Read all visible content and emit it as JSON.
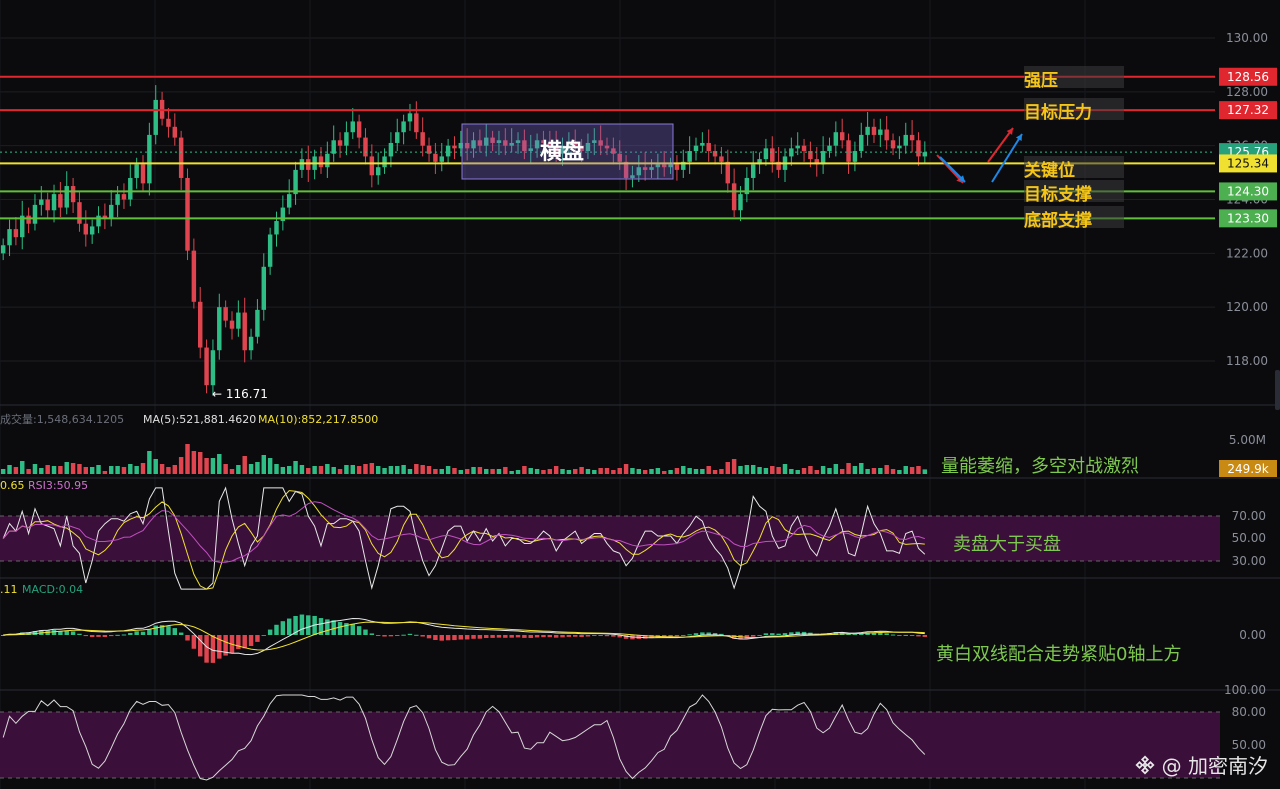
{
  "colors": {
    "background": "#0b0b0e",
    "up": "#2ebd85",
    "down": "#e0454f",
    "resistance_line": "#e0272f",
    "key_line": "#f0e130",
    "support_line": "#5fbf3a",
    "label_gold": "#f5c518",
    "note_green": "#7ec850",
    "osc_band": "#3a0f3a"
  },
  "annotations": {
    "strong_resistance": "强压",
    "target_resistance": "目标压力",
    "key_level": "关键位",
    "target_support": "目标支撑",
    "bottom_support": "底部支撑",
    "consolidation": "横盘",
    "volume_note": "量能萎缩，多空对战激烈",
    "rsi_note": "卖盘大于买盘",
    "macd_note": "黄白双线配合走势紧贴0轴上方",
    "low_marker": "← 116.71"
  },
  "watermark": {
    "text": "@ 加密南汐",
    "icon": "binance-logo-icon"
  },
  "chart_data": {
    "type": "candlestick",
    "price_axis": {
      "ticks": [
        "130.00",
        "128.00",
        "126.00",
        "124.00",
        "122.00",
        "120.00",
        "118.00"
      ],
      "ylim": [
        116.0,
        130.5
      ]
    },
    "price_tags": [
      {
        "value": "128.56",
        "kind": "resistance"
      },
      {
        "value": "127.32",
        "kind": "resistance"
      },
      {
        "value": "125.76",
        "kind": "current"
      },
      {
        "value": "125.34",
        "kind": "key"
      },
      {
        "value": "124.30",
        "kind": "support"
      },
      {
        "value": "123.30",
        "kind": "support"
      }
    ],
    "levels": [
      {
        "label": "强压",
        "price": 128.56,
        "color": "#e0272f"
      },
      {
        "label": "目标压力",
        "price": 127.32,
        "color": "#e0272f"
      },
      {
        "label": "关键位",
        "price": 125.34,
        "color": "#f0e130"
      },
      {
        "label": "目标支撑",
        "price": 124.3,
        "color": "#5fbf3a"
      },
      {
        "label": "底部支撑",
        "price": 123.3,
        "color": "#5fbf3a"
      }
    ],
    "low": 116.71,
    "close": [
      122.3,
      122.9,
      122.6,
      123.4,
      123.1,
      123.8,
      124.0,
      123.6,
      124.2,
      123.7,
      124.5,
      123.9,
      123.1,
      122.7,
      123.0,
      123.4,
      123.3,
      123.8,
      124.2,
      124.0,
      124.8,
      125.3,
      124.6,
      126.4,
      127.7,
      127.0,
      126.7,
      126.3,
      124.8,
      122.1,
      120.2,
      118.5,
      117.1,
      118.4,
      120.0,
      119.5,
      119.2,
      119.8,
      118.4,
      118.9,
      119.9,
      121.5,
      122.7,
      123.2,
      123.7,
      124.2,
      125.1,
      125.5,
      125.1,
      125.6,
      125.2,
      125.7,
      126.2,
      126.0,
      126.5,
      126.9,
      126.3,
      125.6,
      124.9,
      125.2,
      125.6,
      126.1,
      126.5,
      126.9,
      127.2,
      126.5,
      126.0,
      125.7,
      125.4,
      125.6,
      126.0,
      125.9,
      126.1,
      125.9,
      126.2,
      126.0,
      126.3,
      126.1,
      126.2,
      126.0,
      126.1,
      126.2,
      125.8,
      125.9,
      126.2,
      126.1,
      126.0,
      125.7,
      126.0,
      126.1,
      126.0,
      125.8,
      126.1,
      126.2,
      126.0,
      125.9,
      125.7,
      125.4,
      124.8,
      124.9,
      125.2,
      125.1,
      125.2,
      125.3,
      125.2,
      125.3,
      125.1,
      125.4,
      125.8,
      126.0,
      126.1,
      125.8,
      125.6,
      125.4,
      124.6,
      123.6,
      124.2,
      124.8,
      125.3,
      125.5,
      125.9,
      125.4,
      125.1,
      125.6,
      125.9,
      126.0,
      125.8,
      125.5,
      125.3,
      125.8,
      126.0,
      126.5,
      126.2,
      125.4,
      125.8,
      126.4,
      126.7,
      126.4,
      126.6,
      126.2,
      125.9,
      126.0,
      126.4,
      126.2,
      125.6,
      125.76
    ],
    "volume": {
      "label": "成交量:1,548,634.1205",
      "ma5_label": "MA(5):521,881.4620",
      "ma10_label": "MA(10):852,217.8500",
      "ticks": [
        "5.00M"
      ],
      "current_tag": "249.9k"
    },
    "rsi": {
      "label_left": "0.65",
      "label_rsi3": "RSI3:50.95",
      "ticks": [
        "70.00",
        "50.00",
        "30.00"
      ]
    },
    "macd": {
      "label_left": ".11",
      "label_macd": "MACD:0.04",
      "ticks": [
        "0.00"
      ]
    },
    "stoch": {
      "ticks": [
        "100.00",
        "80.00",
        "50.00"
      ]
    }
  }
}
